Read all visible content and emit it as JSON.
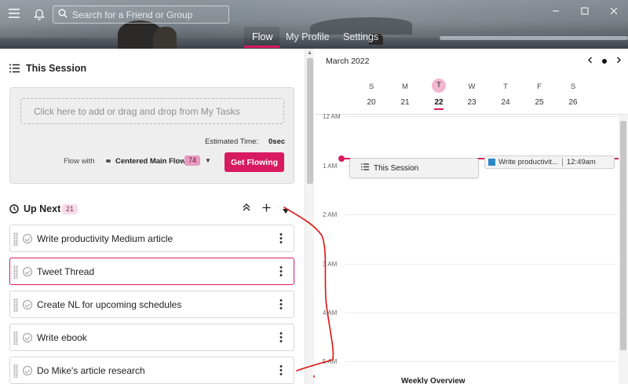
{
  "header": {
    "search_placeholder": "Search for a Friend or Group",
    "nav": [
      {
        "label": "Flow",
        "active": true
      },
      {
        "label": "My Profile",
        "active": false
      },
      {
        "label": "Settings",
        "active": false
      }
    ],
    "accent": "#d81b60"
  },
  "session": {
    "title": "This Session",
    "dropzone": "Click here to add or drag and drop from My Tasks",
    "estimated_label": "Estimated Time:",
    "estimated_value": "0sec",
    "flow_with_label": "Flow with",
    "flow_name": "Centered Main Flow",
    "flow_count": "74",
    "cta": "Get Flowing"
  },
  "up_next": {
    "title": "Up Next",
    "count": "21",
    "tasks": [
      {
        "label": "Write productivity Medium article",
        "selected": false
      },
      {
        "label": "Tweet Thread",
        "selected": true
      },
      {
        "label": "Create NL for upcoming schedules",
        "selected": false
      },
      {
        "label": "Write ebook",
        "selected": false
      },
      {
        "label": "Do Mike's article research",
        "selected": false
      }
    ]
  },
  "calendar": {
    "month": "March 2022",
    "days": [
      {
        "dow": "S",
        "date": "20",
        "today": false
      },
      {
        "dow": "M",
        "date": "21",
        "today": false
      },
      {
        "dow": "T",
        "date": "22",
        "today": true
      },
      {
        "dow": "W",
        "date": "23",
        "today": false
      },
      {
        "dow": "T",
        "date": "24",
        "today": false
      },
      {
        "dow": "F",
        "date": "25",
        "today": false
      },
      {
        "dow": "S",
        "date": "26",
        "today": false
      }
    ],
    "hours": [
      "12 AM",
      "1 AM",
      "2 AM",
      "3 AM",
      "4 AM",
      "5 AM"
    ],
    "events": {
      "session_label": "This Session",
      "task_label": "Write productivit...",
      "task_time": "12:49am"
    },
    "footer": "Weekly Overview"
  }
}
